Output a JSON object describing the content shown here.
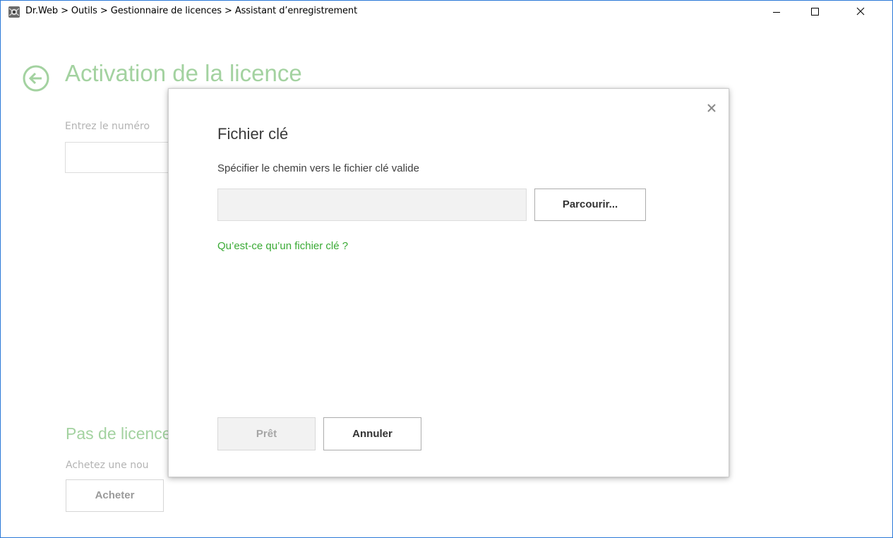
{
  "window": {
    "title": "Dr.Web > Outils > Gestionnaire de licences > Assistant d’enregistrement"
  },
  "page": {
    "title": "Activation de la licence",
    "prompt": "Entrez le numéro",
    "no_license_title": "Pas de licence",
    "no_license_text": "Achetez une nou",
    "buy_label": "Acheter"
  },
  "dialog": {
    "title": "Fichier clé",
    "label": "Spécifier le chemin vers le fichier clé valide",
    "path_value": "",
    "browse_label": "Parcourir...",
    "help_link": "Qu’est-ce qu’un fichier clé ?",
    "ok_label": "Prêt",
    "cancel_label": "Annuler"
  },
  "colors": {
    "accent_green": "#3aaa35",
    "faded_green": "#a3d2a0",
    "window_border": "#2b79d7"
  },
  "icons": {
    "app": "drweb-spider-icon",
    "back": "back-arrow-circle-icon",
    "minimize": "minimize-icon",
    "maximize": "maximize-icon",
    "close": "close-icon"
  }
}
